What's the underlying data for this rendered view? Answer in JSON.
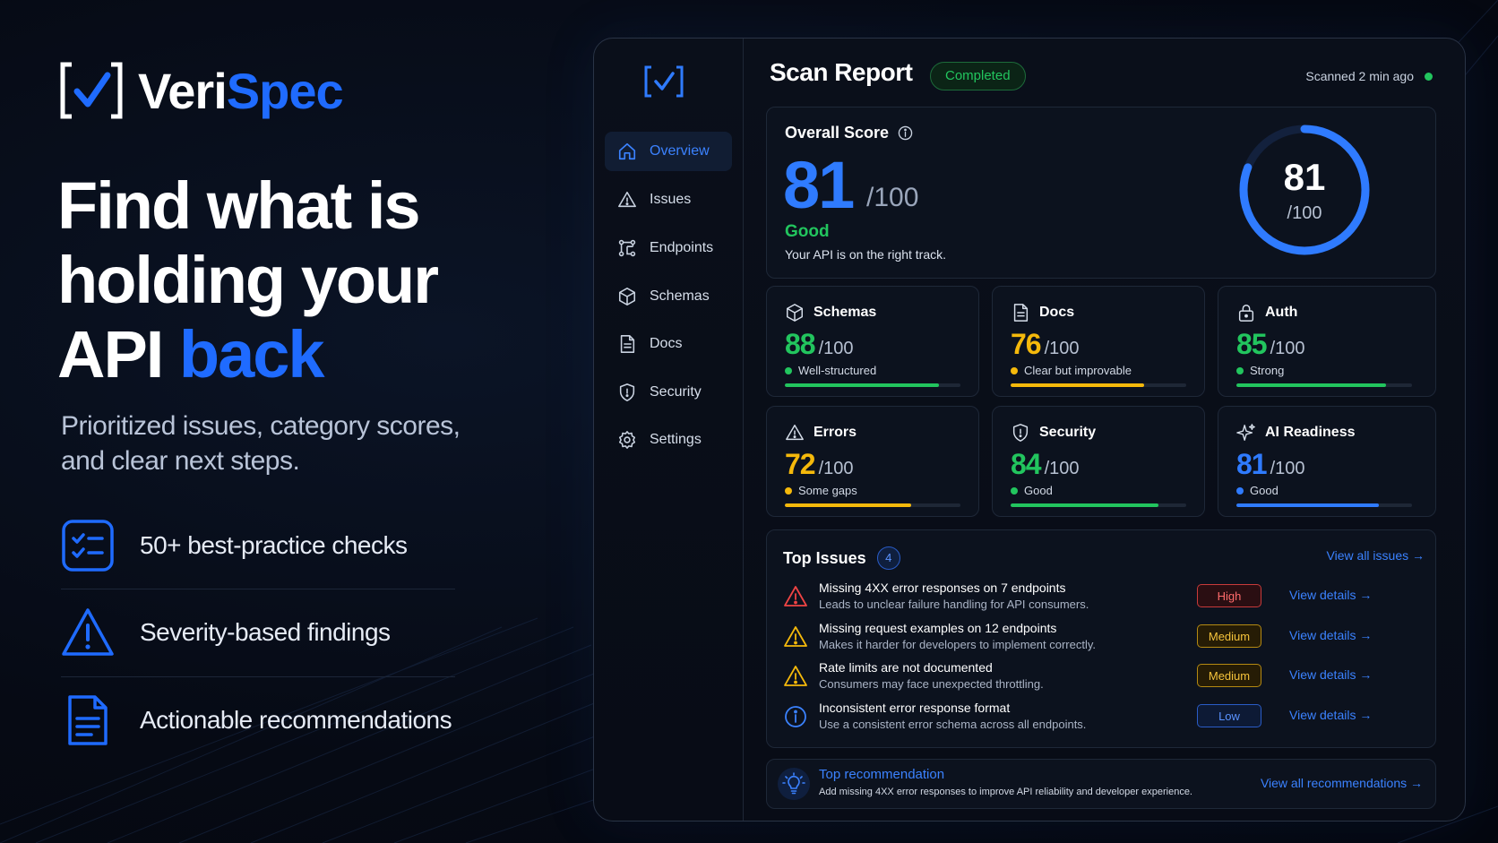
{
  "brand": {
    "name_part1": "Veri",
    "name_part2": "Spec",
    "accent": "#1f6bff"
  },
  "hero": {
    "line1": "Find what is",
    "line2": "holding your",
    "line3_plain": "API ",
    "line3_accent": "back",
    "sub_line1": "Prioritized issues, category scores,",
    "sub_line2": "and clear next steps."
  },
  "features": [
    {
      "icon": "checklist-icon",
      "label": "50+ best-practice checks"
    },
    {
      "icon": "warning-icon",
      "label": "Severity-based findings"
    },
    {
      "icon": "document-icon",
      "label": "Actionable recommendations"
    }
  ],
  "sidebar": {
    "items": [
      {
        "label": "Overview",
        "icon": "home-icon",
        "active": true
      },
      {
        "label": "Issues",
        "icon": "warning-icon"
      },
      {
        "label": "Endpoints",
        "icon": "endpoints-icon"
      },
      {
        "label": "Schemas",
        "icon": "cube-icon"
      },
      {
        "label": "Docs",
        "icon": "document-icon"
      },
      {
        "label": "Security",
        "icon": "shield-icon"
      },
      {
        "label": "Settings",
        "icon": "gear-icon"
      }
    ]
  },
  "header": {
    "title": "Scan Report",
    "status": "Completed",
    "scanned": "Scanned 2 min ago"
  },
  "overall": {
    "label": "Overall Score",
    "score": "81",
    "max": "/100",
    "gauge_score": "81",
    "gauge_max": "/100",
    "gauge_fraction": 0.81,
    "rating": "Good",
    "description": "Your API is on the right track."
  },
  "categories": [
    {
      "name": "Schemas",
      "icon": "cube-icon",
      "score": "88",
      "max": "/100",
      "status": "Well-structured",
      "color": "#22c55e",
      "fraction": 0.88
    },
    {
      "name": "Docs",
      "icon": "document-icon",
      "score": "76",
      "max": "/100",
      "status": "Clear but improvable",
      "color": "#f5b90b",
      "fraction": 0.76
    },
    {
      "name": "Auth",
      "icon": "lock-icon",
      "score": "85",
      "max": "/100",
      "status": "Strong",
      "color": "#22c55e",
      "fraction": 0.85
    },
    {
      "name": "Errors",
      "icon": "warning-icon",
      "score": "72",
      "max": "/100",
      "status": "Some gaps",
      "color": "#f5b90b",
      "fraction": 0.72
    },
    {
      "name": "Security",
      "icon": "shield-icon",
      "score": "84",
      "max": "/100",
      "status": "Good",
      "color": "#22c55e",
      "fraction": 0.84
    },
    {
      "name": "AI Readiness",
      "icon": "sparkle-icon",
      "score": "81",
      "max": "/100",
      "status": "Good",
      "color": "#2f7bff",
      "fraction": 0.81
    }
  ],
  "issues": {
    "title": "Top Issues",
    "count": "4",
    "view_all": "View all issues →",
    "items": [
      {
        "title": "Missing 4XX error responses on 7 endpoints",
        "desc": "Leads to unclear failure handling for API consumers.",
        "severity": "High",
        "level": "high",
        "link": "View details →"
      },
      {
        "title": "Missing request examples on 12 endpoints",
        "desc": "Makes it harder for developers to implement correctly.",
        "severity": "Medium",
        "level": "med",
        "link": "View details →"
      },
      {
        "title": "Rate limits are not documented",
        "desc": "Consumers may face unexpected throttling.",
        "severity": "Medium",
        "level": "med",
        "link": "View details →"
      },
      {
        "title": "Inconsistent error response format",
        "desc": "Use a consistent error schema across all endpoints.",
        "severity": "Low",
        "level": "low",
        "link": "View details →"
      }
    ]
  },
  "recommendation": {
    "title": "Top recommendation",
    "desc": "Add missing 4XX error responses to improve API reliability and developer experience.",
    "link": "View all recommendations →"
  }
}
